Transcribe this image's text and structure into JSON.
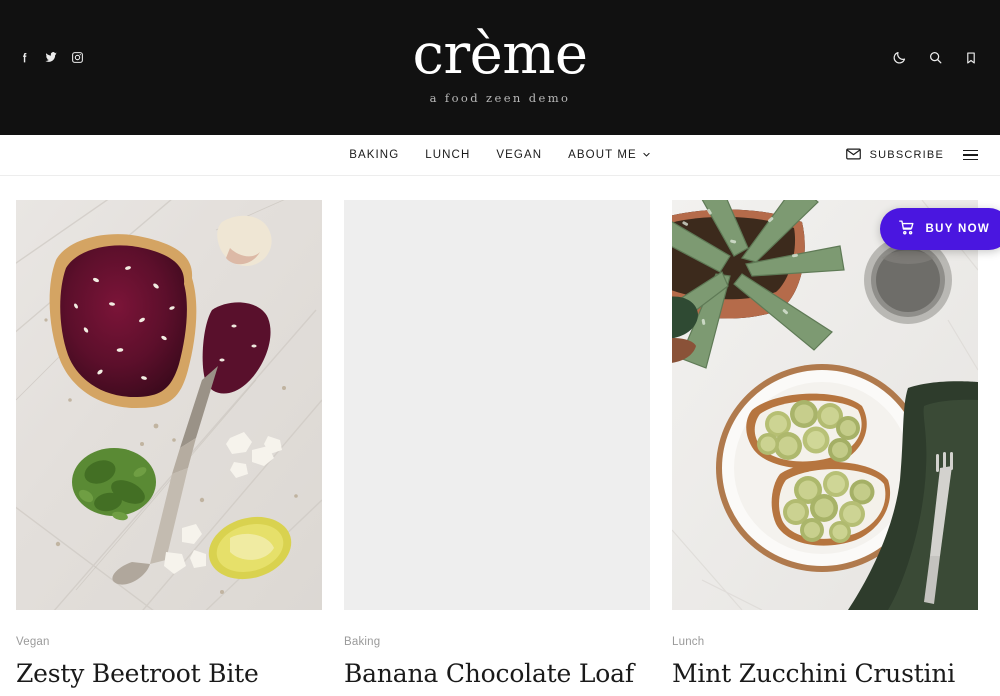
{
  "site": {
    "brand_title": "crème",
    "tagline": "a food zeen demo",
    "accent_color": "#4a16e0",
    "header_bg": "#111111",
    "page_bg": "#ffffff"
  },
  "social": [
    {
      "name": "facebook-icon",
      "label": "Facebook"
    },
    {
      "name": "twitter-icon",
      "label": "Twitter"
    },
    {
      "name": "instagram-icon",
      "label": "Instagram"
    }
  ],
  "header_utils": [
    {
      "name": "dark-mode-icon",
      "label": "Dark mode"
    },
    {
      "name": "search-icon",
      "label": "Search"
    },
    {
      "name": "bookmark-icon",
      "label": "Saved"
    }
  ],
  "nav": {
    "items": [
      {
        "label": "BAKING",
        "has_dropdown": false
      },
      {
        "label": "LUNCH",
        "has_dropdown": false
      },
      {
        "label": "VEGAN",
        "has_dropdown": false
      },
      {
        "label": "ABOUT ME",
        "has_dropdown": true
      }
    ],
    "subscribe_label": "SUBSCRIBE",
    "menu_label": "Menu"
  },
  "buy_now": {
    "label": "BUY NOW"
  },
  "posts": [
    {
      "category": "Vegan",
      "title": "Zesty Beetroot Bite",
      "image": "beetroot-toast-on-marble"
    },
    {
      "category": "Baking",
      "title": "Banana Chocolate Loaf",
      "image": "image-placeholder"
    },
    {
      "category": "Lunch",
      "title": "Mint Zucchini Crustini",
      "image": "zucchini-crostini-plate"
    }
  ]
}
